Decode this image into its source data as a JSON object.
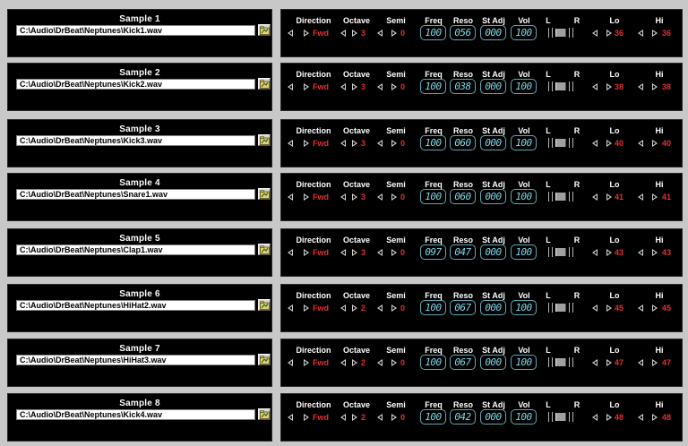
{
  "labels": {
    "direction": "Direction",
    "octave": "Octave",
    "semi": "Semi",
    "freq": "Freq",
    "reso": "Reso",
    "st_adj": "St Adj",
    "vol": "Vol",
    "pan_l": "L",
    "pan_r": "R",
    "lo": "Lo",
    "hi": "Hi"
  },
  "colors": {
    "panel_bg": "#000000",
    "page_bg": "#c8c8c8",
    "value_red": "#e03030",
    "lcd_cyan": "#7fd8e8"
  },
  "icons": {
    "browse": "folder-browse-icon",
    "arrow_left": "arrow-left-icon",
    "arrow_right": "arrow-right-icon"
  },
  "samples": [
    {
      "title": "Sample  1",
      "path": "C:\\Audio\\DrBeat\\Neptunes\\Kick1.wav",
      "direction": "Fwd",
      "octave": "3",
      "semi": "0",
      "freq": "100",
      "reso": "056",
      "st_adj": "000",
      "vol": "100",
      "lo": "36",
      "hi": "36",
      "pan": 0.5
    },
    {
      "title": "Sample  2",
      "path": "C:\\Audio\\DrBeat\\Neptunes\\Kick2.wav",
      "direction": "Fwd",
      "octave": "3",
      "semi": "0",
      "freq": "100",
      "reso": "038",
      "st_adj": "000",
      "vol": "100",
      "lo": "38",
      "hi": "38",
      "pan": 0.5
    },
    {
      "title": "Sample  3",
      "path": "C:\\Audio\\DrBeat\\Neptunes\\Kick3.wav",
      "direction": "Fwd",
      "octave": "3",
      "semi": "0",
      "freq": "100",
      "reso": "060",
      "st_adj": "000",
      "vol": "100",
      "lo": "40",
      "hi": "40",
      "pan": 0.5
    },
    {
      "title": "Sample  4",
      "path": "C:\\Audio\\DrBeat\\Neptunes\\Snare1.wav",
      "direction": "Fwd",
      "octave": "3",
      "semi": "0",
      "freq": "100",
      "reso": "060",
      "st_adj": "000",
      "vol": "100",
      "lo": "41",
      "hi": "41",
      "pan": 0.5
    },
    {
      "title": "Sample  5",
      "path": "C:\\Audio\\DrBeat\\Neptunes\\Clap1.wav",
      "direction": "Fwd",
      "octave": "3",
      "semi": "0",
      "freq": "097",
      "reso": "047",
      "st_adj": "000",
      "vol": "100",
      "lo": "43",
      "hi": "43",
      "pan": 0.5
    },
    {
      "title": "Sample  6",
      "path": "C:\\Audio\\DrBeat\\Neptunes\\HiHat2.wav",
      "direction": "Fwd",
      "octave": "2",
      "semi": "0",
      "freq": "100",
      "reso": "067",
      "st_adj": "000",
      "vol": "100",
      "lo": "45",
      "hi": "45",
      "pan": 0.5
    },
    {
      "title": "Sample  7",
      "path": "C:\\Audio\\DrBeat\\Neptunes\\HiHat3.wav",
      "direction": "Fwd",
      "octave": "2",
      "semi": "0",
      "freq": "100",
      "reso": "067",
      "st_adj": "000",
      "vol": "100",
      "lo": "47",
      "hi": "47",
      "pan": 0.5
    },
    {
      "title": "Sample  8",
      "path": "C:\\Audio\\DrBeat\\Neptunes\\Kick4.wav",
      "direction": "Fwd",
      "octave": "2",
      "semi": "0",
      "freq": "100",
      "reso": "042",
      "st_adj": "000",
      "vol": "100",
      "lo": "48",
      "hi": "48",
      "pan": 0.5
    }
  ]
}
